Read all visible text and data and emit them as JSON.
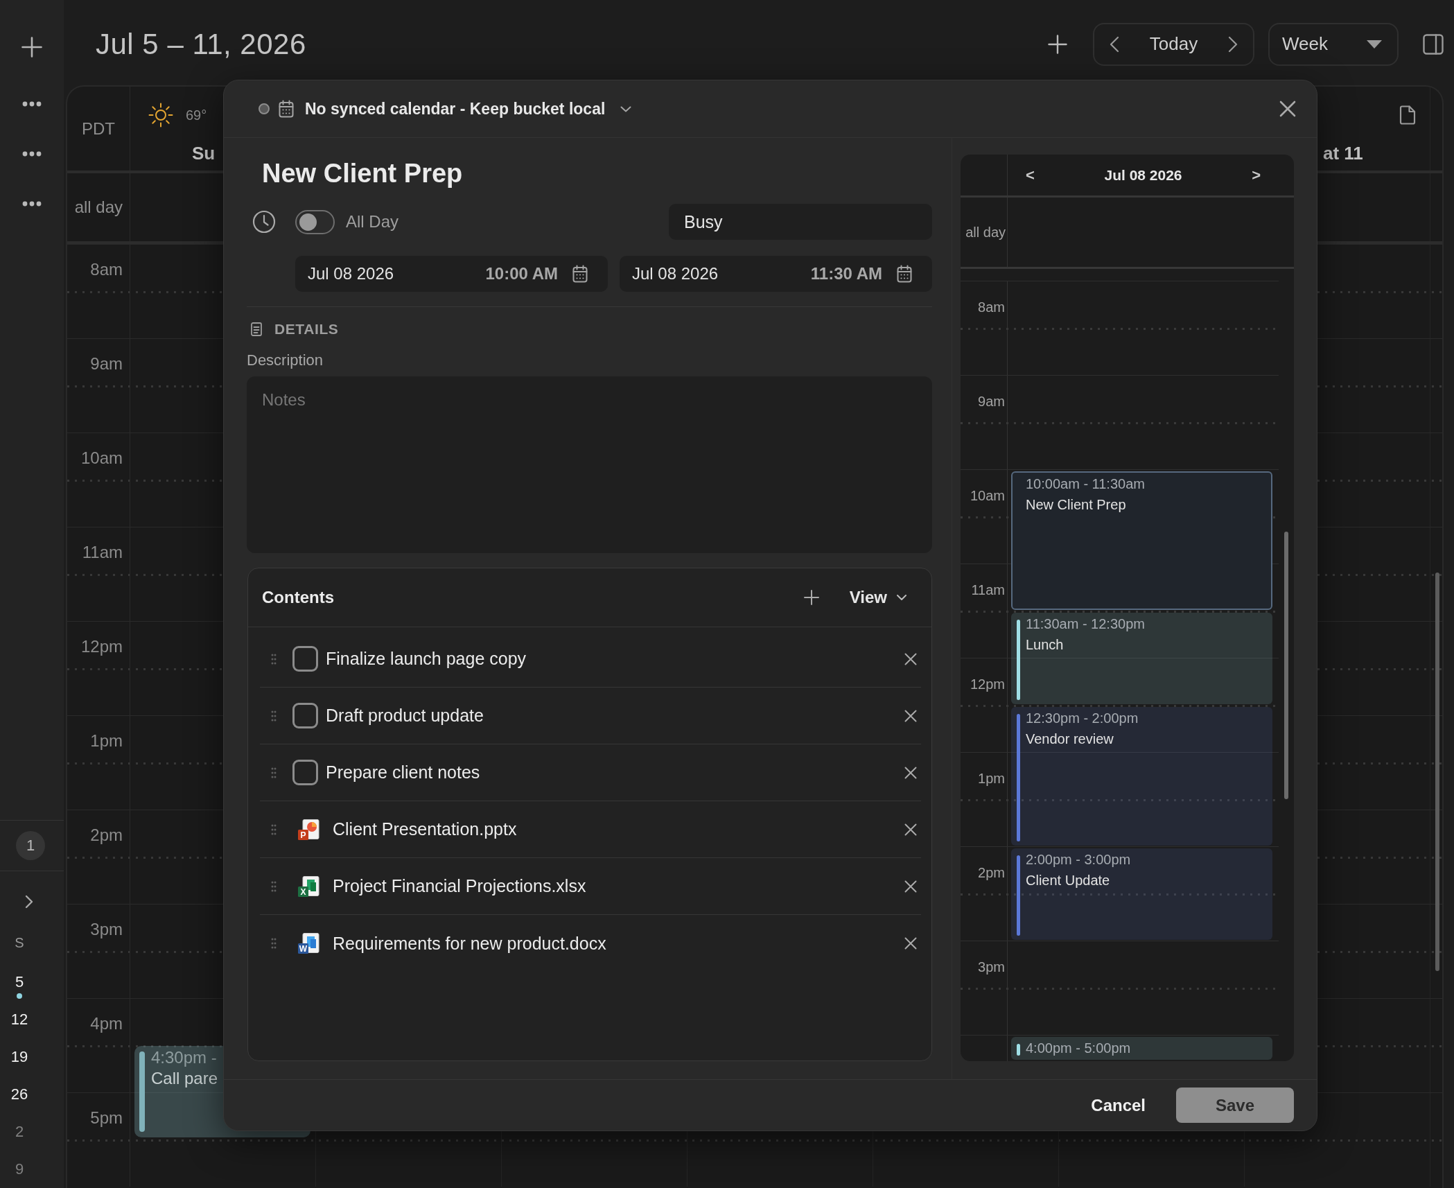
{
  "rail": {
    "badge": "1",
    "month": {
      "weekday": "S",
      "days": [
        {
          "label": "5",
          "in_month": true,
          "has_events": true
        },
        {
          "label": "12",
          "in_month": true,
          "has_events": false
        },
        {
          "label": "19",
          "in_month": true,
          "has_events": false
        },
        {
          "label": "26",
          "in_month": true,
          "has_events": false
        },
        {
          "label": "2",
          "in_month": false,
          "has_events": false
        },
        {
          "label": "9",
          "in_month": false,
          "has_events": false
        }
      ]
    }
  },
  "header": {
    "title": "Jul 5 – 11, 2026",
    "today_button": "Today",
    "view_select": "Week"
  },
  "week_grid": {
    "timezone": "PDT",
    "all_day_label": "all day",
    "days": [
      {
        "label": "Su",
        "weather": "69°"
      },
      {
        "label": "at 11"
      }
    ],
    "hours": [
      {
        "label": "8am"
      },
      {
        "label": "9am"
      },
      {
        "label": "10am"
      },
      {
        "label": "11am"
      },
      {
        "label": "12pm"
      },
      {
        "label": "1pm"
      },
      {
        "label": "2pm"
      },
      {
        "label": "3pm"
      },
      {
        "label": "4pm",
        "events": [
          {
            "time": "4:30pm -",
            "title": "Call pare",
            "color": "#80b2ba",
            "half_past": true,
            "extra_half_hour": false
          }
        ]
      },
      {
        "label": "5pm"
      }
    ]
  },
  "event_dialog": {
    "calendar": "No synced calendar - Keep bucket local",
    "title": "New Client Prep",
    "all_day": {
      "label": "All Day",
      "on": false
    },
    "availability": "Busy",
    "start": {
      "date": "Jul 08 2026",
      "time": "10:00 AM"
    },
    "end": {
      "date": "Jul 08 2026",
      "time": "11:30 AM"
    },
    "details_heading": "DETAILS",
    "description": {
      "label": "Description",
      "placeholder": "Notes"
    },
    "contents": {
      "title": "Contents",
      "view_button": "View",
      "items": [
        {
          "kind": "task",
          "label": "Finalize launch page copy",
          "checked": false
        },
        {
          "kind": "task",
          "label": "Draft product update",
          "checked": false
        },
        {
          "kind": "task",
          "label": "Prepare client notes",
          "checked": false
        },
        {
          "kind": "pptx",
          "icon_letter": "P",
          "label": "Client Presentation.pptx"
        },
        {
          "kind": "xlsx",
          "icon_letter": "X",
          "label": "Project Financial Projections.xlsx"
        },
        {
          "kind": "docx",
          "icon_letter": "W",
          "label": "Requirements for new product.docx"
        }
      ]
    },
    "day_view": {
      "prev": "<",
      "title": "Jul 08 2026",
      "next": ">",
      "all_day_label": "all day",
      "hours": [
        {
          "label": "8am"
        },
        {
          "label": "9am"
        },
        {
          "label": "10am",
          "events": [
            {
              "kind": "draft",
              "time": "10:00am - 11:30am",
              "title": "New Client Prep",
              "half_past": false,
              "extra_half_hour": true
            }
          ]
        },
        {
          "label": "11am",
          "events": [
            {
              "kind": "event",
              "time": "11:30am - 12:30pm",
              "title": "Lunch",
              "color": "#9fdfe6",
              "half_past": true,
              "extra_half_hour": false
            }
          ]
        },
        {
          "label": "12pm",
          "events": [
            {
              "kind": "event",
              "time": "12:30pm - 2:00pm",
              "title": "Vendor review",
              "color": "#5b78d8",
              "half_past": true,
              "extra_half_hour": true
            }
          ]
        },
        {
          "label": "1pm"
        },
        {
          "label": "2pm",
          "events": [
            {
              "kind": "event",
              "time": "2:00pm - 3:00pm",
              "title": "Client Update",
              "color": "#5b78d8",
              "half_past": false,
              "extra_half_hour": false
            }
          ]
        },
        {
          "label": "3pm"
        },
        {
          "events": [
            {
              "kind": "event",
              "time": "4:00pm - 5:00pm",
              "color": "#9fdfe6",
              "half_past": false
            }
          ]
        }
      ]
    },
    "buttons": [
      {
        "kind": "secondary",
        "label": "Cancel",
        "disabled": false
      },
      {
        "kind": "primary",
        "label": "Save",
        "disabled": true
      }
    ]
  }
}
